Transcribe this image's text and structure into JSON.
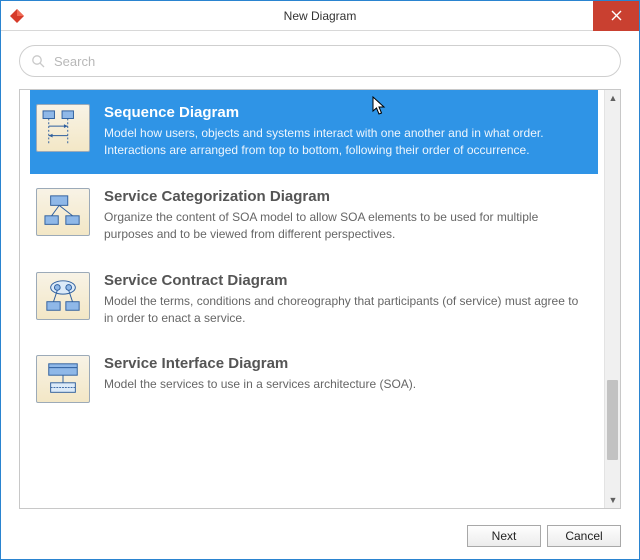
{
  "window": {
    "title": "New Diagram"
  },
  "search": {
    "placeholder": "Search",
    "value": ""
  },
  "items": [
    {
      "title": "Sequence Diagram",
      "desc": "Model how users, objects and systems interact with one another and in what order. Interactions are arranged from top to bottom, following their order of occurrence.",
      "selected": true
    },
    {
      "title": "Service Categorization Diagram",
      "desc": "Organize the content of SOA model to allow SOA elements to be used for multiple purposes and to be viewed from different perspectives.",
      "selected": false
    },
    {
      "title": "Service Contract Diagram",
      "desc": "Model the terms, conditions and choreography that participants (of service) must agree to in order to enact a service.",
      "selected": false
    },
    {
      "title": "Service Interface Diagram",
      "desc": "Model the services to use in a services architecture (SOA).",
      "selected": false
    }
  ],
  "buttons": {
    "next": "Next",
    "cancel": "Cancel"
  }
}
